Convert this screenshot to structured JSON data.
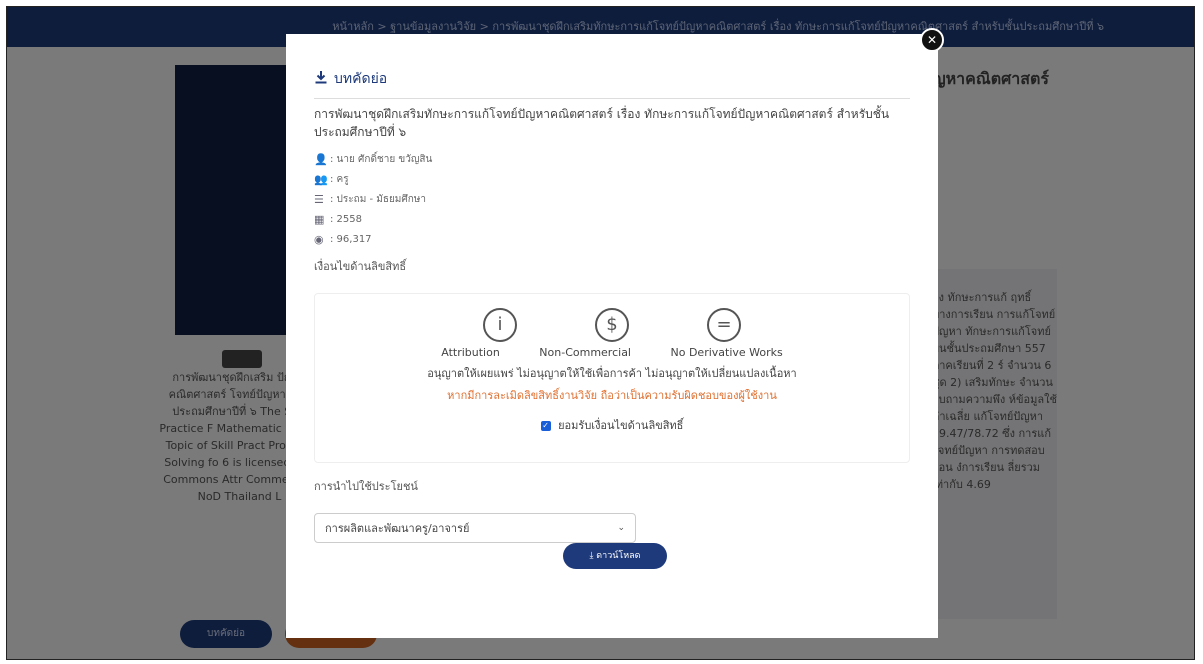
{
  "background": {
    "breadcrumb": "หน้าหลัก > ฐานข้อมูลงานวิจัย > การพัฒนาชุดฝึกเสริมทักษะการแก้โจทย์ปัญหาคณิตศาสตร์ เรื่อง ทักษะการแก้โจทย์ปัญหาคณิตศาสตร์ สำหรับชั้นประถมศึกษาปีที่ ๖",
    "title_fragment": "ญหาคณิตศาสตร์",
    "left_text": "การพัฒนาชุดฝึกเสริม ปัญหาคณิตศาสตร์ โจทย์ปัญหาคณิต ประถมศึกษาปีที่ ๖ The Skill Practice F Mathematic Proble Topic of Skill Pract Problem Solving fo 6 is licensed und Commons Attr Commercial-NoD Thailand L",
    "right_text": "อง ทักษะการแก้ ฤทธิ์ทางการเรียน การแก้โจทย์ปัญหา ทักษะการแก้โจทย์ บนชั้นประถมศึกษา 557 ภาคเรียนที่ 2 ร์ จำนวน 6 ชุด 2) เสริมทักษะ จำนวน อบถามความพึง ห์ข้อมูลใช้ค่าเฉลี่ย แก้โจทย์ปัญหา 79.47/78.72 ซึ่ง การแก้โจทย์ปัญหา การทดสอบก่อน ง๋การเรียน ลี่ยรวมเท่ากับ 4.69",
    "abstract_button": "บทคัดย่อ"
  },
  "modal": {
    "header": "บทคัดย่อ",
    "title": "การพัฒนาชุดฝึกเสริมทักษะการแก้โจทย์ปัญหาคณิตศาสตร์ เรื่อง ทักษะการแก้โจทย์ปัญหาคณิตศาสตร์ สำหรับชั้นประถมศึกษาปีที่ ๖",
    "author": ": นาย ศักดิ์ชาย ขวัญสิน",
    "role": ": ครู",
    "level": ": ประถม - มัธยมศึกษา",
    "year": ": 2558",
    "views": ": 96,317",
    "license_label": "เงื่อนไขด้านลิขสิทธิ์",
    "license_names": [
      "Attribution",
      "Non-Commercial",
      "No Derivative Works"
    ],
    "license_desc": "อนุญาตให้เผยแพร่ ไม่อนุญาตให้ใช้เพื่อการค้า ไม่อนุญาตให้เปลี่ยนแปลงเนื้อหา",
    "license_warning": "หากมีการละเมิดลิขสิทธิ์งานวิจัย ถือว่าเป็นความรับผิดชอบของผู้ใช้งาน",
    "accept_label": "ยอมรับเงื่อนไขด้านลิขสิทธิ์",
    "use_label": "การนำไปใช้ประโยชน์",
    "use_selected": "การผลิตและพัฒนาครู/อาจารย์",
    "download_label": "ดาวน์โหลด"
  },
  "colors": {
    "primary": "#1e3a7b",
    "warning": "#e07030",
    "checkbox": "#1a5ed8"
  },
  "icons": {
    "close": "close-icon",
    "download": "download-icon",
    "person": "person-icon",
    "role": "group-icon",
    "level": "list-icon",
    "year": "calendar-icon",
    "views": "eye-icon"
  }
}
